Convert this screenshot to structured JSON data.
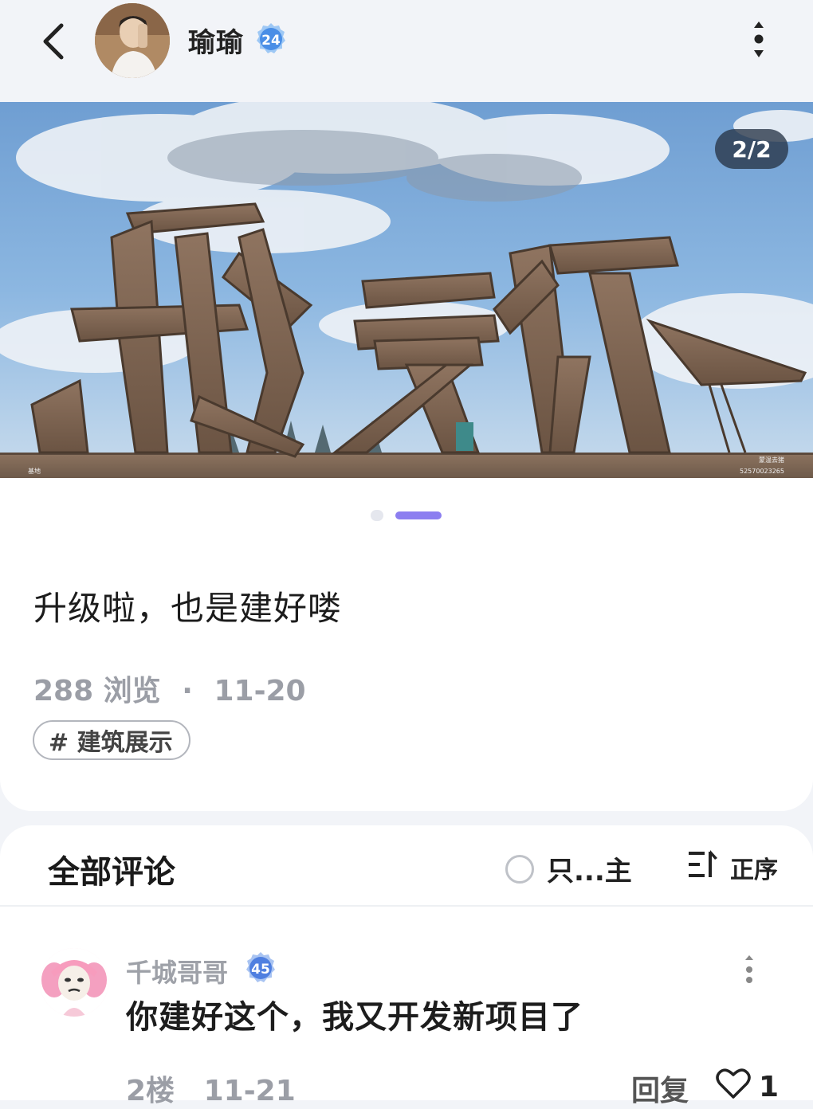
{
  "header": {
    "username": "瑜瑜",
    "level": "24"
  },
  "image": {
    "counter": "2/2",
    "caption_left": "基地",
    "caption_right_line1": "蒙温去猪",
    "caption_right_line2": "52570023265"
  },
  "post": {
    "text": "升级啦，也是建好喽",
    "views": "288 浏览",
    "separator": "·",
    "date": "11-20",
    "tag": "# 建筑展示"
  },
  "comments": {
    "title": "全部评论",
    "only_host": "只...主",
    "sort": "正序",
    "items": [
      {
        "name": "千城哥哥",
        "level": "45",
        "text": "你建好这个，我又开发新项目了",
        "floor": "2楼",
        "date": "11-21",
        "reply": "回复",
        "likes": "1"
      }
    ]
  }
}
